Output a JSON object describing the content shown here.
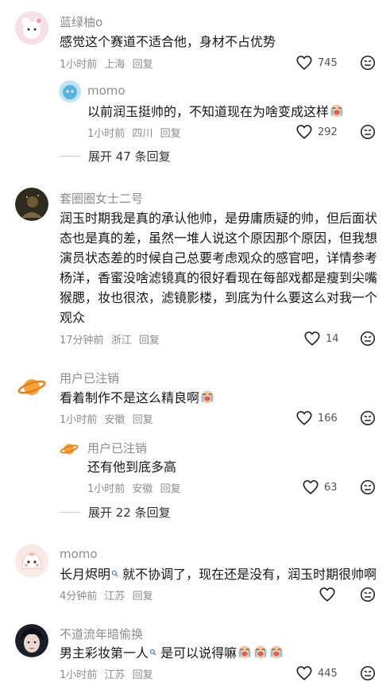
{
  "comments": [
    {
      "username": "蓝绿柚o",
      "text": "感觉这个赛道不适合他，身材不占优势",
      "time": "1小时前",
      "location": "上海",
      "reply": "回复",
      "likes": "745"
    },
    {
      "username": "momo",
      "text": "以前润玉挺帅的，不知道现在为啥变成这样",
      "time": "1小时前",
      "location": "四川",
      "reply": "回复",
      "likes": "292",
      "expand": "展开 47 条回复"
    },
    {
      "username": "套圈圈女士二号",
      "text_lines": [
        "润玉时期我是真的承认他帅，是毋庸质疑的帅，但后面状",
        "态也是真的差，虽然一堆人说这个原因那个原因，但我想",
        "演员状态差的时候自己总要考虑观众的感官吧，详情参考",
        "杨洋，香蜜没啥滤镜真的很好看现在每部戏都是瘦到尖嘴",
        "猴腮，妆也很浓，滤镜影楼，到底为什么要这么对我一个",
        "观众"
      ],
      "time": "17分钟前",
      "location": "浙江",
      "reply": "回复",
      "likes": "14"
    },
    {
      "username": "用户已注销",
      "text": "看着制作不是这么精良啊",
      "time": "1小时前",
      "location": "安徽",
      "reply": "回复",
      "likes": "166"
    },
    {
      "username": "用户已注销",
      "text": "还有他到底多高",
      "time": "1小时前",
      "location": "安徽",
      "reply": "回复",
      "likes": "63",
      "expand": "展开 22 条回复"
    },
    {
      "username": "momo",
      "text_a": "长月烬明",
      "text_b": " 就不协调了，现在还是没有，润玉时期很帅啊",
      "time": "4分钟前",
      "location": "江苏",
      "reply": "回复"
    },
    {
      "username": "不道流年暗偷换",
      "text_a": "男主彩妆第一人",
      "text_b": " 是可以说得嘛",
      "time": "1小时前",
      "location": "江苏",
      "reply": "回复",
      "likes": "445"
    }
  ],
  "icons": {
    "like": "heart-outline-icon",
    "dislike": "dislike-face-icon",
    "cry_emoji": "crying-face-emoji",
    "search_mention": "search-mention-icon"
  },
  "colors": {
    "meta_gray": "#8c8c8c",
    "text": "#161616"
  }
}
